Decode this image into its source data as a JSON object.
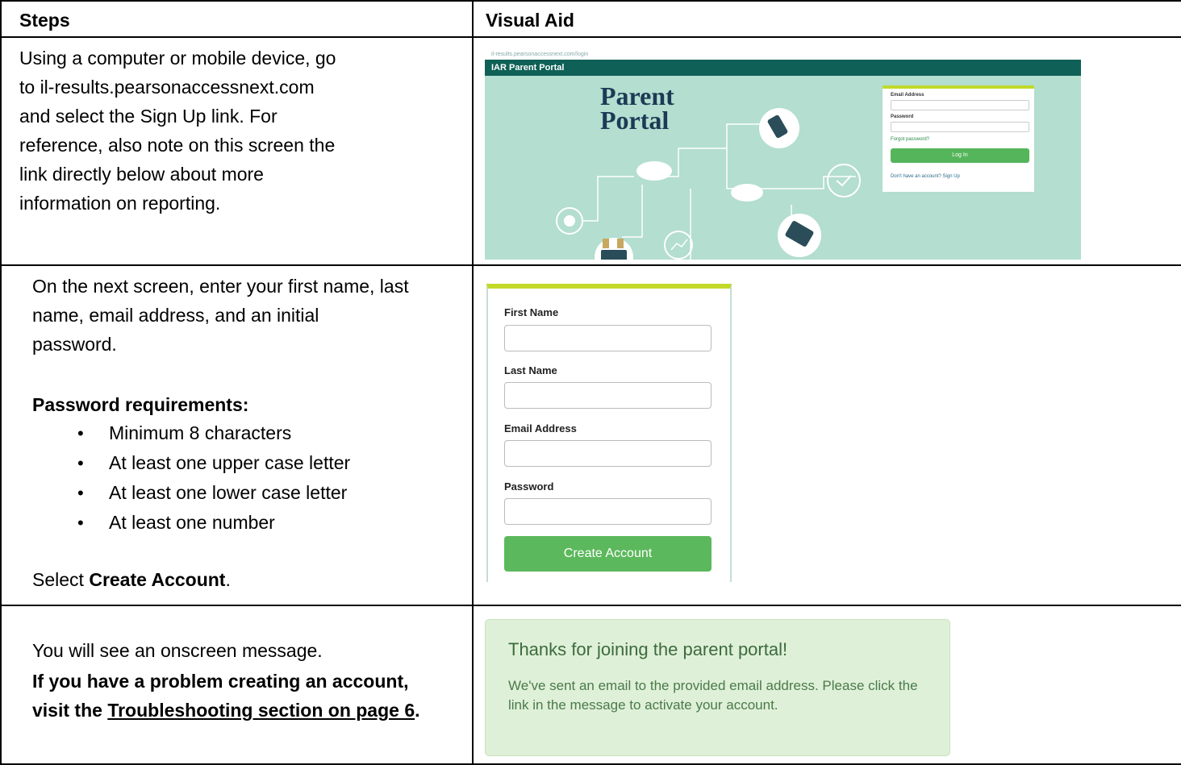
{
  "table": {
    "headers": {
      "steps": "Steps",
      "visual_aid": "Visual Aid"
    },
    "row1": {
      "line1": "Using a computer or mobile device, go",
      "line2": "to il-results.pearsonaccessnext.com",
      "line3": "and select the Sign Up link. For",
      "line4": "reference, also note on this screen the",
      "line5": "link directly below about more",
      "line6": "information on reporting."
    },
    "row2": {
      "line1": "On the next screen, enter your first name, last",
      "line2": "name, email address, and an initial",
      "line3": "password.",
      "pw_heading": "Password requirements:",
      "requirements": [
        "Minimum 8 characters",
        "At least one upper case letter",
        "At least one lower case letter",
        "At least one number"
      ],
      "select_prefix": "Select ",
      "select_bold": "Create Account",
      "select_suffix": "."
    },
    "row3": {
      "line1": "You will see an onscreen message.",
      "bold_line1": "If you have a problem creating an account,",
      "bold_line2_prefix": "visit the ",
      "bold_link": "Troubleshooting section on page 6",
      "bold_suffix": "."
    }
  },
  "portal": {
    "url": "il-results.pearsonaccessnext.com/login",
    "topbar": "IAR Parent Portal",
    "title_line1": "Parent",
    "title_line2": "Portal",
    "email_label": "Email Address",
    "password_label": "Password",
    "forgot": "Forgot password?",
    "login_button": "Log In",
    "signup_text": "Don't have an account? Sign Up"
  },
  "signup_form": {
    "first_name": "First Name",
    "last_name": "Last Name",
    "email": "Email Address",
    "password": "Password",
    "button": "Create Account"
  },
  "message": {
    "title": "Thanks for joining the parent portal!",
    "body": "We've sent an email to the provided email address. Please click the link in the message to activate your account."
  }
}
